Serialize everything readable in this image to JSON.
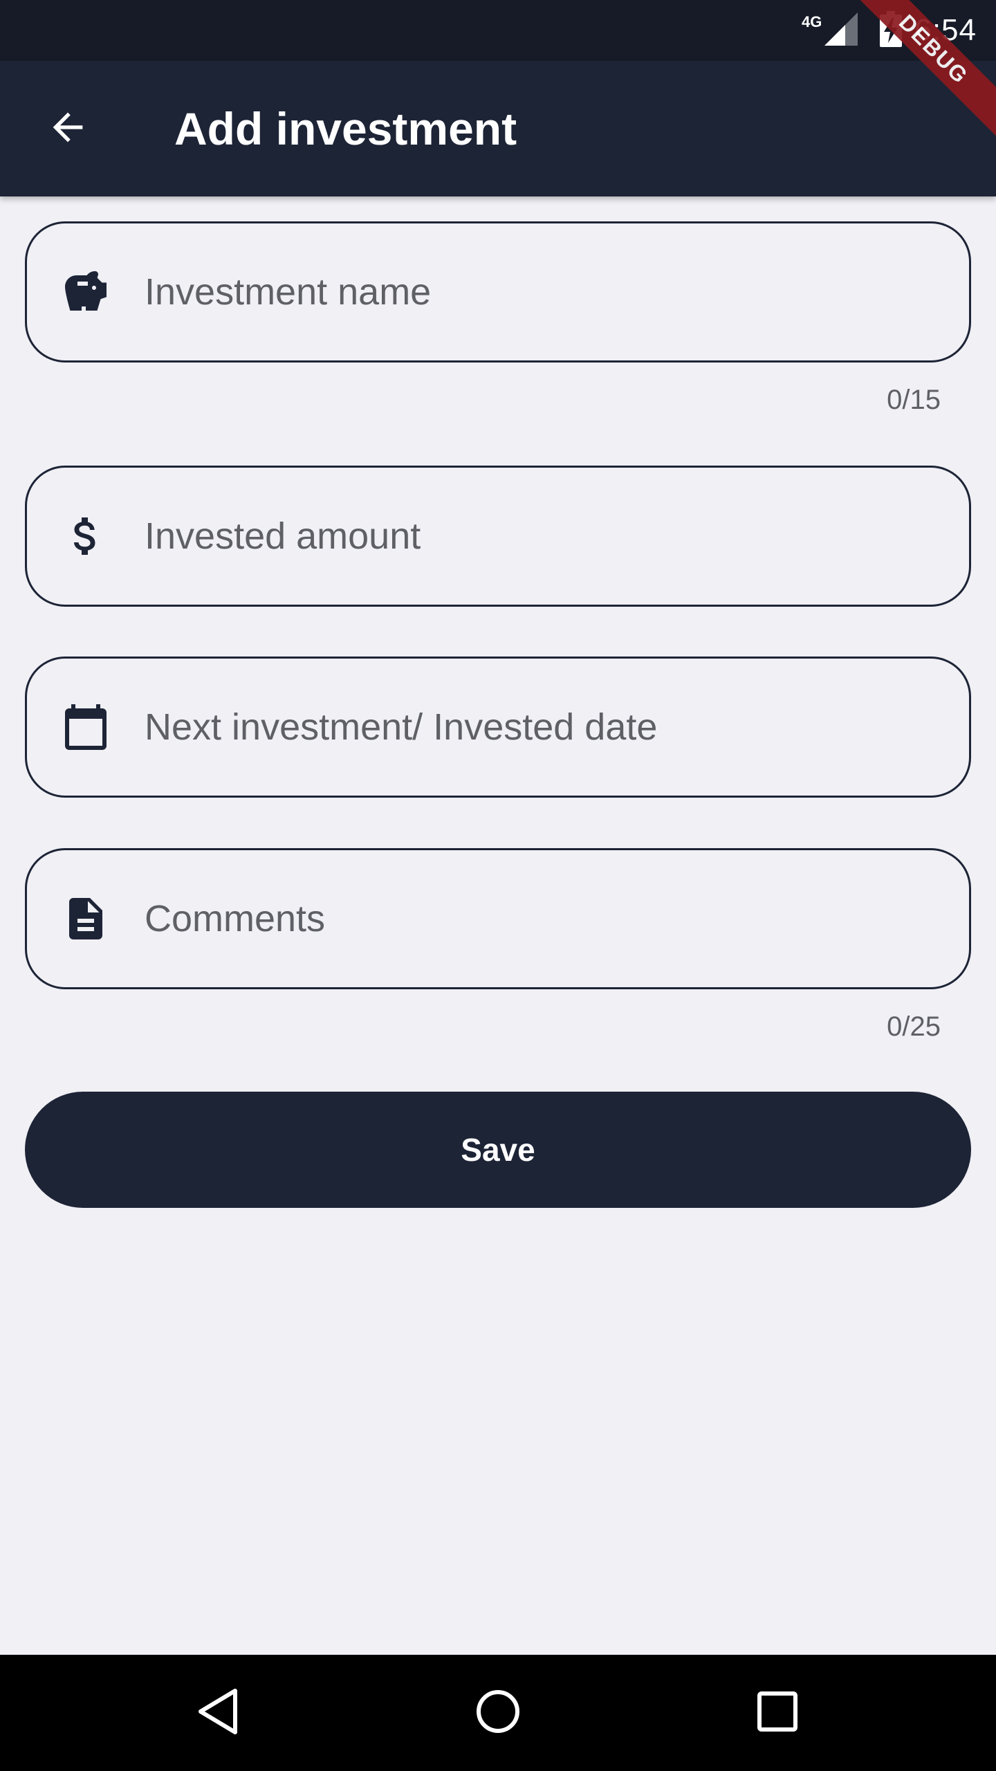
{
  "status_bar": {
    "network": "4G",
    "time": "6:54",
    "debug_label": "DEBUG"
  },
  "app_bar": {
    "title": "Add investment",
    "back_icon": "arrow-back-icon"
  },
  "form": {
    "investment_name": {
      "icon": "piggy-bank-icon",
      "placeholder": "Investment name",
      "value": "",
      "counter": "0/15"
    },
    "invested_amount": {
      "icon": "dollar-icon",
      "placeholder": "Invested amount",
      "value": ""
    },
    "date": {
      "icon": "calendar-icon",
      "placeholder": "Next investment/ Invested date",
      "value": ""
    },
    "comments": {
      "icon": "document-icon",
      "placeholder": "Comments",
      "value": "",
      "counter": "0/25"
    },
    "save_label": "Save"
  },
  "nav_bar": {
    "back_icon": "triangle-back-icon",
    "home_icon": "circle-home-icon",
    "recents_icon": "square-recents-icon"
  },
  "colors": {
    "primary": "#1d2436",
    "background": "#f0f0f5",
    "status_bar": "#161b27",
    "debug_ribbon": "#8b1a1f"
  }
}
